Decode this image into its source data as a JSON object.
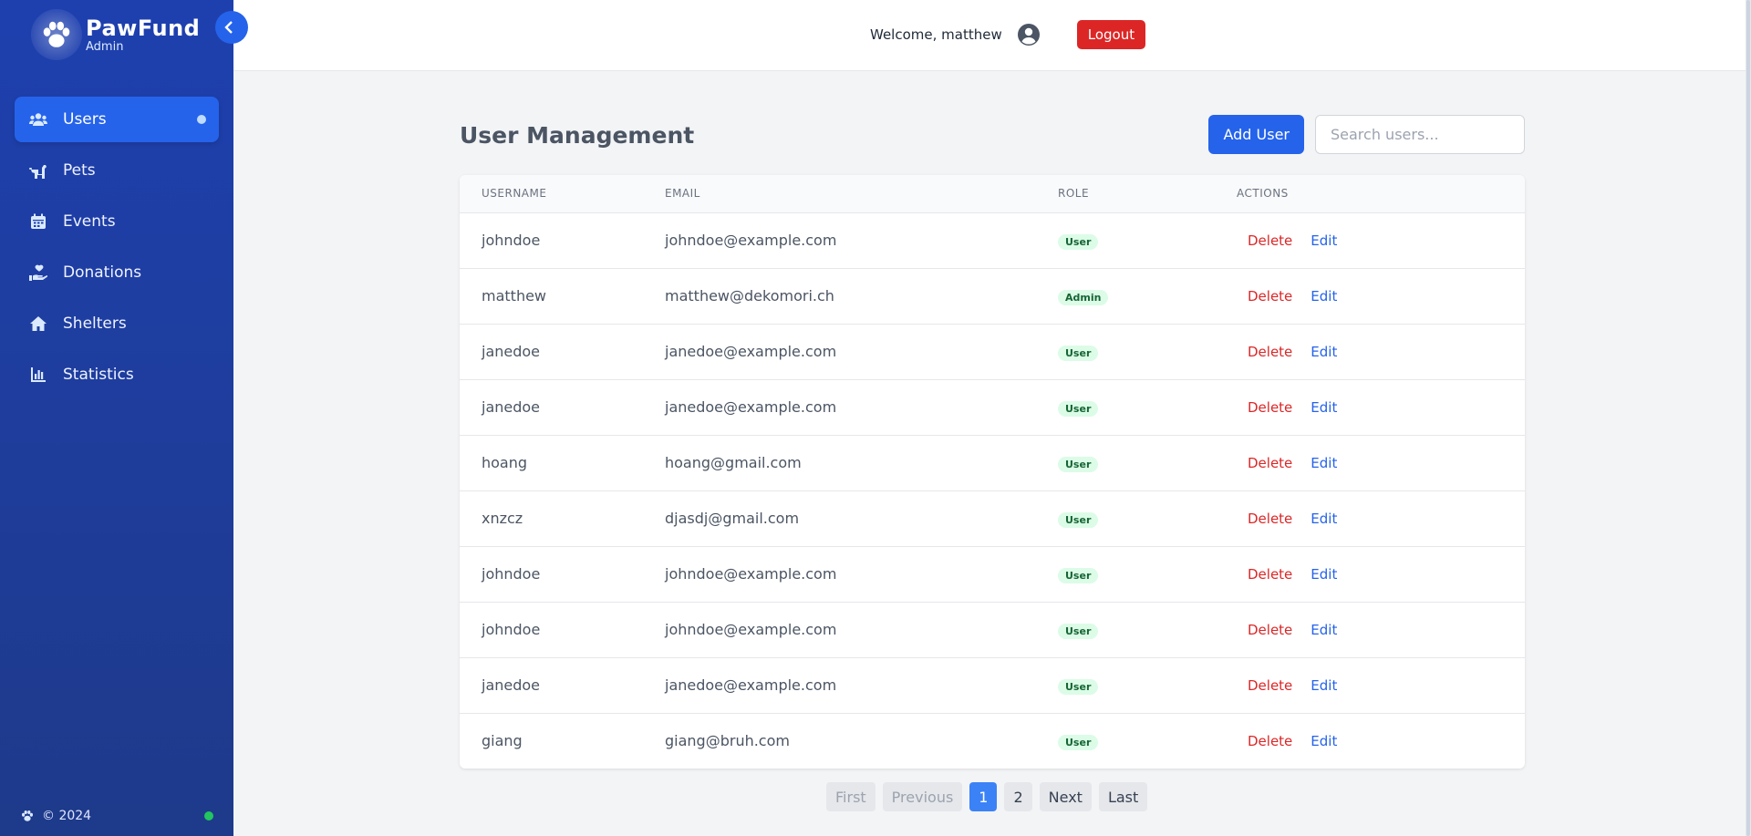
{
  "app": {
    "name": "PawFund",
    "subtitle": "Admin"
  },
  "sidebar": {
    "items": [
      {
        "label": "Users",
        "icon": "users-icon",
        "active": true
      },
      {
        "label": "Pets",
        "icon": "dog-icon"
      },
      {
        "label": "Events",
        "icon": "calendar-icon"
      },
      {
        "label": "Donations",
        "icon": "hand-holding-heart-icon"
      },
      {
        "label": "Shelters",
        "icon": "home-icon"
      },
      {
        "label": "Statistics",
        "icon": "chart-bar-icon"
      }
    ],
    "footer": "© 2024"
  },
  "header": {
    "welcome": "Welcome, matthew",
    "logout_label": "Logout"
  },
  "main": {
    "title": "User Management",
    "add_label": "Add User",
    "search_placeholder": "Search users...",
    "columns": [
      "USERNAME",
      "EMAIL",
      "ROLE",
      "ACTIONS"
    ],
    "rows": [
      {
        "username": "johndoe",
        "email": "johndoe@example.com",
        "role": "User"
      },
      {
        "username": "matthew",
        "email": "matthew@dekomori.ch",
        "role": "Admin"
      },
      {
        "username": "janedoe",
        "email": "janedoe@example.com",
        "role": "User"
      },
      {
        "username": "janedoe",
        "email": "janedoe@example.com",
        "role": "User"
      },
      {
        "username": "hoang",
        "email": "hoang@gmail.com",
        "role": "User"
      },
      {
        "username": "xnzcz",
        "email": "djasdj@gmail.com",
        "role": "User"
      },
      {
        "username": "johndoe",
        "email": "johndoe@example.com",
        "role": "User"
      },
      {
        "username": "johndoe",
        "email": "johndoe@example.com",
        "role": "User"
      },
      {
        "username": "janedoe",
        "email": "janedoe@example.com",
        "role": "User"
      },
      {
        "username": "giang",
        "email": "giang@bruh.com",
        "role": "User"
      }
    ],
    "delete_label": "Delete",
    "edit_label": "Edit"
  },
  "pagination": {
    "first": "First",
    "previous": "Previous",
    "pages": [
      "1",
      "2"
    ],
    "current": "1",
    "next": "Next",
    "last": "Last"
  },
  "colors": {
    "sidebar": "#1e40af",
    "accent": "#2563eb",
    "danger": "#dc2626",
    "badge_bg": "#dcfce7",
    "badge_text": "#166534"
  }
}
